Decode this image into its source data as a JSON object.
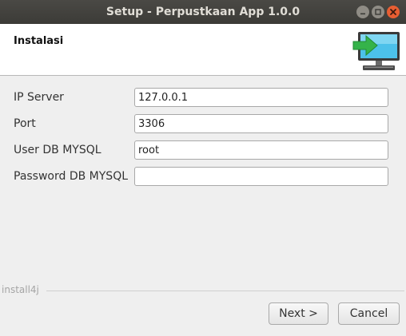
{
  "window": {
    "title": "Setup - Perpustkaan App 1.0.0",
    "controls": {
      "minimize_icon": "minimize-icon",
      "maximize_icon": "maximize-icon",
      "close_icon": "close-icon"
    }
  },
  "header": {
    "title": "Instalasi",
    "logo_icon": "install-monitor-icon"
  },
  "form": {
    "fields": [
      {
        "label": "IP Server",
        "value": "127.0.0.1",
        "placeholder": ""
      },
      {
        "label": "Port",
        "value": "3306",
        "placeholder": ""
      },
      {
        "label": "User DB MYSQL",
        "value": "root",
        "placeholder": ""
      },
      {
        "label": "Password DB MYSQL",
        "value": "",
        "placeholder": ""
      }
    ]
  },
  "footer": {
    "brand": "install4j",
    "next_label": "Next >",
    "cancel_label": "Cancel"
  },
  "colors": {
    "titlebar": "#3c3b37",
    "close_button": "#e85e32",
    "logo_green": "#35b34a",
    "logo_screen": "#4cc1ea"
  }
}
